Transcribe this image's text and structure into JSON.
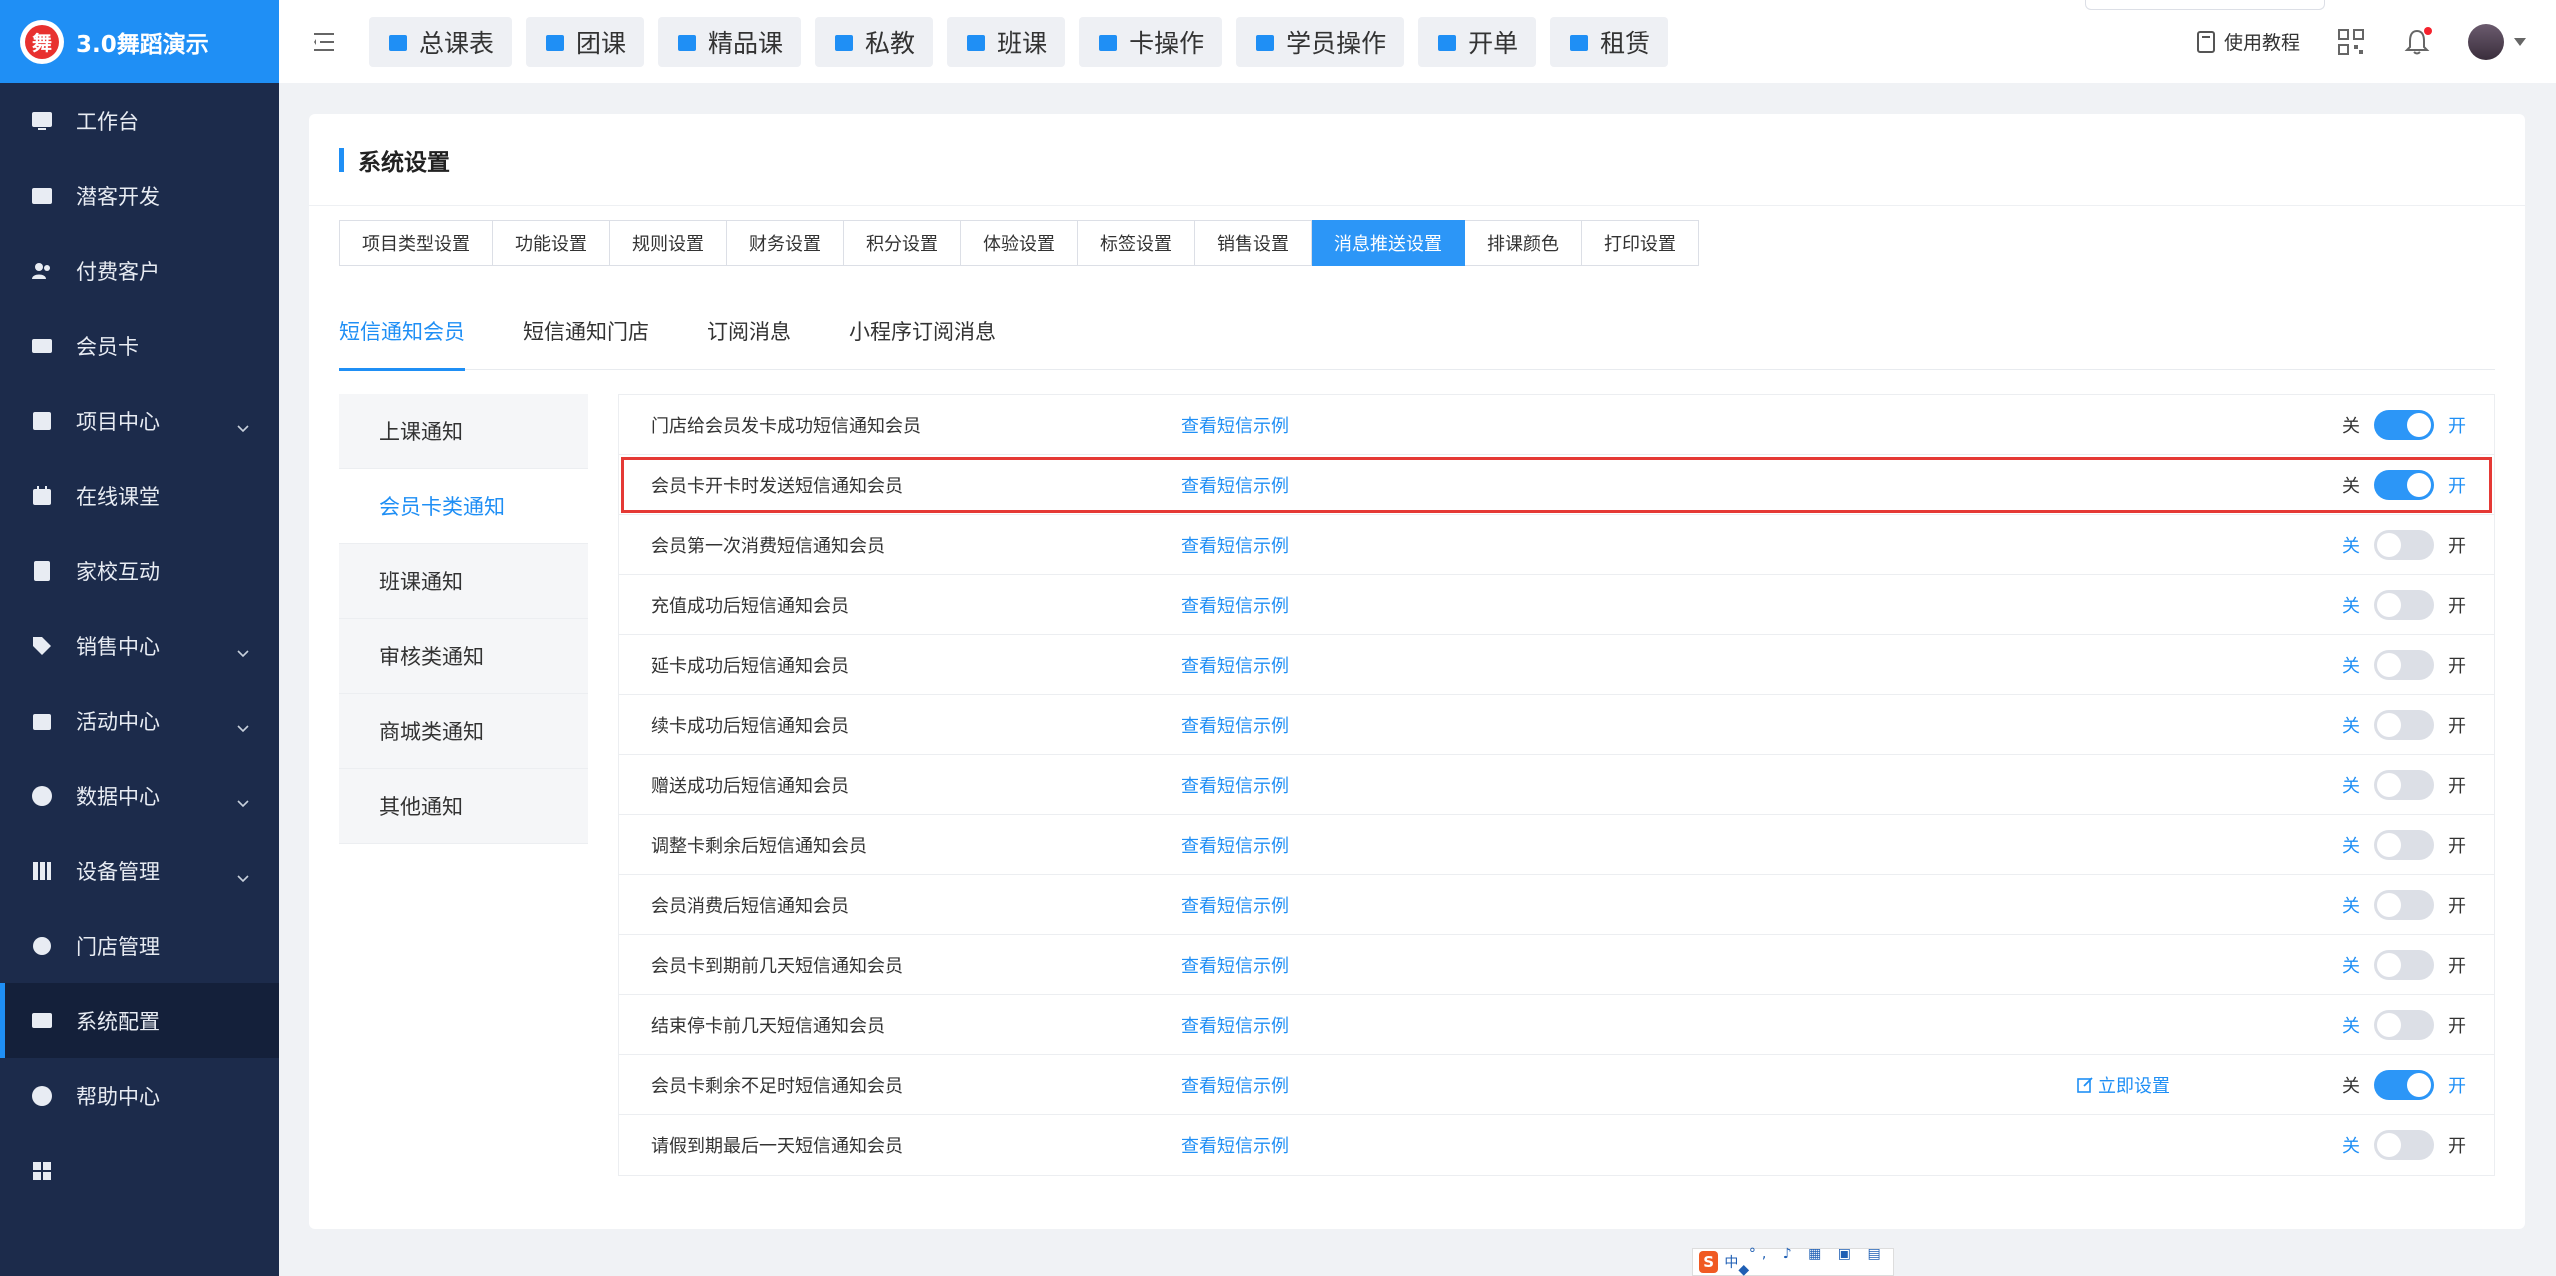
{
  "app": {
    "title": "3.0舞蹈演示",
    "logo_char": "舞"
  },
  "sidebar": {
    "items": [
      {
        "label": "工作台",
        "icon": "monitor-icon",
        "expandable": false,
        "active": false
      },
      {
        "label": "潜客开发",
        "icon": "id-card-icon",
        "expandable": false,
        "active": false
      },
      {
        "label": "付费客户",
        "icon": "users-icon",
        "expandable": false,
        "active": false
      },
      {
        "label": "会员卡",
        "icon": "card-icon",
        "expandable": false,
        "active": false
      },
      {
        "label": "项目中心",
        "icon": "list-icon",
        "expandable": true,
        "active": false
      },
      {
        "label": "在线课堂",
        "icon": "calendar-icon",
        "expandable": false,
        "active": false
      },
      {
        "label": "家校互动",
        "icon": "contact-book-icon",
        "expandable": false,
        "active": false
      },
      {
        "label": "销售中心",
        "icon": "tag-icon",
        "expandable": true,
        "active": false
      },
      {
        "label": "活动中心",
        "icon": "activity-icon",
        "expandable": true,
        "active": false
      },
      {
        "label": "数据中心",
        "icon": "pie-chart-icon",
        "expandable": true,
        "active": false
      },
      {
        "label": "设备管理",
        "icon": "device-icon",
        "expandable": true,
        "active": false
      },
      {
        "label": "门店管理",
        "icon": "store-icon",
        "expandable": false,
        "active": false
      },
      {
        "label": "系统配置",
        "icon": "settings-icon",
        "expandable": false,
        "active": true
      },
      {
        "label": "帮助中心",
        "icon": "help-icon",
        "expandable": false,
        "active": false
      },
      {
        "label": "",
        "icon": "apps-grid-icon",
        "expandable": false,
        "active": false
      }
    ]
  },
  "topbar": {
    "quick_buttons": [
      {
        "label": "总课表",
        "icon": "table-icon"
      },
      {
        "label": "团课",
        "icon": "book-icon"
      },
      {
        "label": "精品课",
        "icon": "star-square-icon"
      },
      {
        "label": "私教",
        "icon": "people-icon"
      },
      {
        "label": "班课",
        "icon": "board-icon"
      },
      {
        "label": "卡操作",
        "icon": "wallet-icon"
      },
      {
        "label": "学员操作",
        "icon": "user-gear-icon"
      },
      {
        "label": "开单",
        "icon": "receipt-icon"
      },
      {
        "label": "租赁",
        "icon": "building-icon"
      }
    ],
    "tutorial_label": "使用教程"
  },
  "main": {
    "title": "系统设置",
    "tabs": [
      {
        "label": "项目类型设置",
        "active": false
      },
      {
        "label": "功能设置",
        "active": false
      },
      {
        "label": "规则设置",
        "active": false
      },
      {
        "label": "财务设置",
        "active": false
      },
      {
        "label": "积分设置",
        "active": false
      },
      {
        "label": "体验设置",
        "active": false
      },
      {
        "label": "标签设置",
        "active": false
      },
      {
        "label": "销售设置",
        "active": false
      },
      {
        "label": "消息推送设置",
        "active": true
      },
      {
        "label": "排课颜色",
        "active": false
      },
      {
        "label": "打印设置",
        "active": false
      }
    ],
    "subtabs": [
      {
        "label": "短信通知会员",
        "active": true
      },
      {
        "label": "短信通知门店",
        "active": false
      },
      {
        "label": "订阅消息",
        "active": false
      },
      {
        "label": "小程序订阅消息",
        "active": false
      }
    ],
    "side_menu": [
      {
        "label": "上课通知",
        "active": false
      },
      {
        "label": "会员卡类通知",
        "active": true
      },
      {
        "label": "班课通知",
        "active": false
      },
      {
        "label": "审核类通知",
        "active": false
      },
      {
        "label": "商城类通知",
        "active": false
      },
      {
        "label": "其他通知",
        "active": false
      }
    ],
    "example_label": "查看短信示例",
    "off_label": "关",
    "on_label": "开",
    "set_now_label": "立即设置",
    "rows": [
      {
        "name": "门店给会员发卡成功短信通知会员",
        "enabled": true,
        "set_now": false,
        "highlight": false
      },
      {
        "name": "会员卡开卡时发送短信通知会员",
        "enabled": true,
        "set_now": false,
        "highlight": true
      },
      {
        "name": "会员第一次消费短信通知会员",
        "enabled": false,
        "set_now": false,
        "highlight": false
      },
      {
        "name": "充值成功后短信通知会员",
        "enabled": false,
        "set_now": false,
        "highlight": false
      },
      {
        "name": "延卡成功后短信通知会员",
        "enabled": false,
        "set_now": false,
        "highlight": false
      },
      {
        "name": "续卡成功后短信通知会员",
        "enabled": false,
        "set_now": false,
        "highlight": false
      },
      {
        "name": "赠送成功后短信通知会员",
        "enabled": false,
        "set_now": false,
        "highlight": false
      },
      {
        "name": "调整卡剩余后短信通知会员",
        "enabled": false,
        "set_now": false,
        "highlight": false
      },
      {
        "name": "会员消费后短信通知会员",
        "enabled": false,
        "set_now": false,
        "highlight": false
      },
      {
        "name": "会员卡到期前几天短信通知会员",
        "enabled": false,
        "set_now": false,
        "highlight": false
      },
      {
        "name": "结束停卡前几天短信通知会员",
        "enabled": false,
        "set_now": false,
        "highlight": false
      },
      {
        "name": "会员卡剩余不足时短信通知会员",
        "enabled": true,
        "set_now": true,
        "highlight": false
      },
      {
        "name": "请假到期最后一天短信通知会员",
        "enabled": false,
        "set_now": false,
        "highlight": false
      }
    ]
  },
  "ime_bar": {
    "label": "中"
  },
  "colors": {
    "accent": "#1f8ff5",
    "sidebar_bg": "#1c2b4b",
    "highlight_border": "#e53935",
    "logo_red": "#e8312f"
  }
}
